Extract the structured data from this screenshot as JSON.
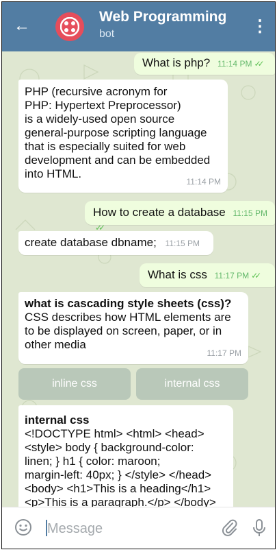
{
  "header": {
    "title": "Web Programming",
    "subtitle": "bot",
    "back_icon": "arrow-left-icon",
    "menu_icon": "more-vertical-icon",
    "avatar_color": "#e64d5b",
    "bar_color": "#527da3"
  },
  "messages": [
    {
      "type": "out",
      "text": "What is php?",
      "time": "11:14 PM"
    },
    {
      "type": "in",
      "lines": [
        "PHP (recursive acronym for",
        "PHP: Hypertext Preprocessor)",
        "is a widely-used open source",
        "general-purpose scripting language",
        "that is especially suited for web",
        "development and can be embedded",
        "into HTML."
      ],
      "time": "11:14 PM"
    },
    {
      "type": "out",
      "text": "How to create a database",
      "time": "11:15 PM"
    },
    {
      "type": "in",
      "text": "create database dbname;",
      "time": "11:15 PM"
    },
    {
      "type": "out",
      "text": "What is css",
      "time": "11:17 PM"
    },
    {
      "type": "in",
      "bold": "what is cascading style sheets (css)?",
      "lines": [
        "CSS describes how HTML elements are",
        "to be displayed on screen, paper, or in",
        "other media"
      ],
      "time": "11:17 PM"
    },
    {
      "type": "in",
      "bold": "internal css",
      "lines": [
        "<!DOCTYPE html> <html> <head>",
        "<style> body {   background-color:",
        "linen; } h1 {   color: maroon;",
        "margin-left: 40px; } </style> </head>",
        "<body>  <h1>This is a heading</h1>",
        "<p>This is a paragraph.</p>  </body>"
      ]
    }
  ],
  "inline_keyboard": [
    {
      "label": "inline css"
    },
    {
      "label": "internal css"
    }
  ],
  "input": {
    "placeholder": "Message",
    "emoji_icon": "smiley-icon",
    "attach_icon": "paperclip-icon",
    "mic_icon": "microphone-icon"
  }
}
